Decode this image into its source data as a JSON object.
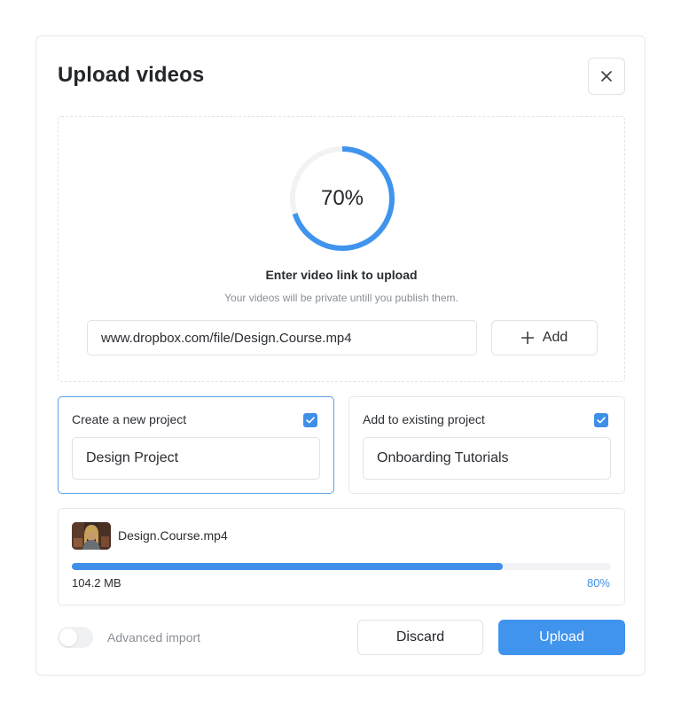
{
  "dialog": {
    "title": "Upload videos",
    "close_icon": "close-icon"
  },
  "dropzone": {
    "progress_percent": 70,
    "progress_label": "70%",
    "heading": "Enter video link to upload",
    "subtext": "Your videos will be private untill you publish them.",
    "link_value": "www.dropbox.com/file/Design.Course.mp4",
    "add_label": "Add",
    "add_icon": "plus-icon"
  },
  "projects": {
    "new": {
      "label": "Create a new project",
      "checked": true,
      "value": "Design Project"
    },
    "existing": {
      "label": "Add to existing project",
      "checked": true,
      "value": "Onboarding Tutorials"
    }
  },
  "file": {
    "name": "Design.Course.mp4",
    "size": "104.2 MB",
    "progress_percent": 80,
    "progress_label": "80%"
  },
  "footer": {
    "toggle_label": "Advanced import",
    "toggle_on": false,
    "discard_label": "Discard",
    "upload_label": "Upload"
  },
  "colors": {
    "accent": "#4094ee",
    "border": "#dfe2e6"
  }
}
